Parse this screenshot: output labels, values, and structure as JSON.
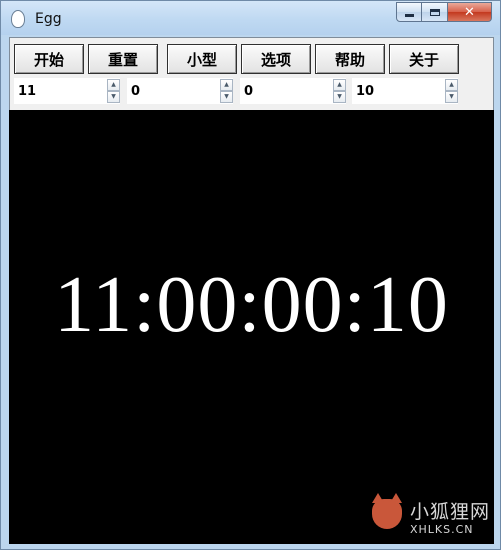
{
  "window": {
    "title": "Egg"
  },
  "toolbar": {
    "buttons": [
      {
        "label": "开始"
      },
      {
        "label": "重置"
      },
      {
        "label": "小型"
      },
      {
        "label": "选项"
      },
      {
        "label": "帮助"
      },
      {
        "label": "关于"
      }
    ]
  },
  "time_fields": [
    {
      "value": "11"
    },
    {
      "value": "0"
    },
    {
      "value": "0"
    },
    {
      "value": "10"
    }
  ],
  "display": {
    "time": "11:00:00:10"
  },
  "watermark": {
    "text_cn": "小狐狸网",
    "text_en": "XHLKS.CN"
  },
  "colors": {
    "display_bg": "#000000",
    "display_fg": "#ffffff",
    "titlebar": "#bfd9f2",
    "close_button": "#c3391f"
  },
  "icons": [
    "app-icon",
    "minimize-icon",
    "maximize-icon",
    "close-icon",
    "spin-up-icon",
    "spin-down-icon",
    "fox-logo-icon"
  ]
}
